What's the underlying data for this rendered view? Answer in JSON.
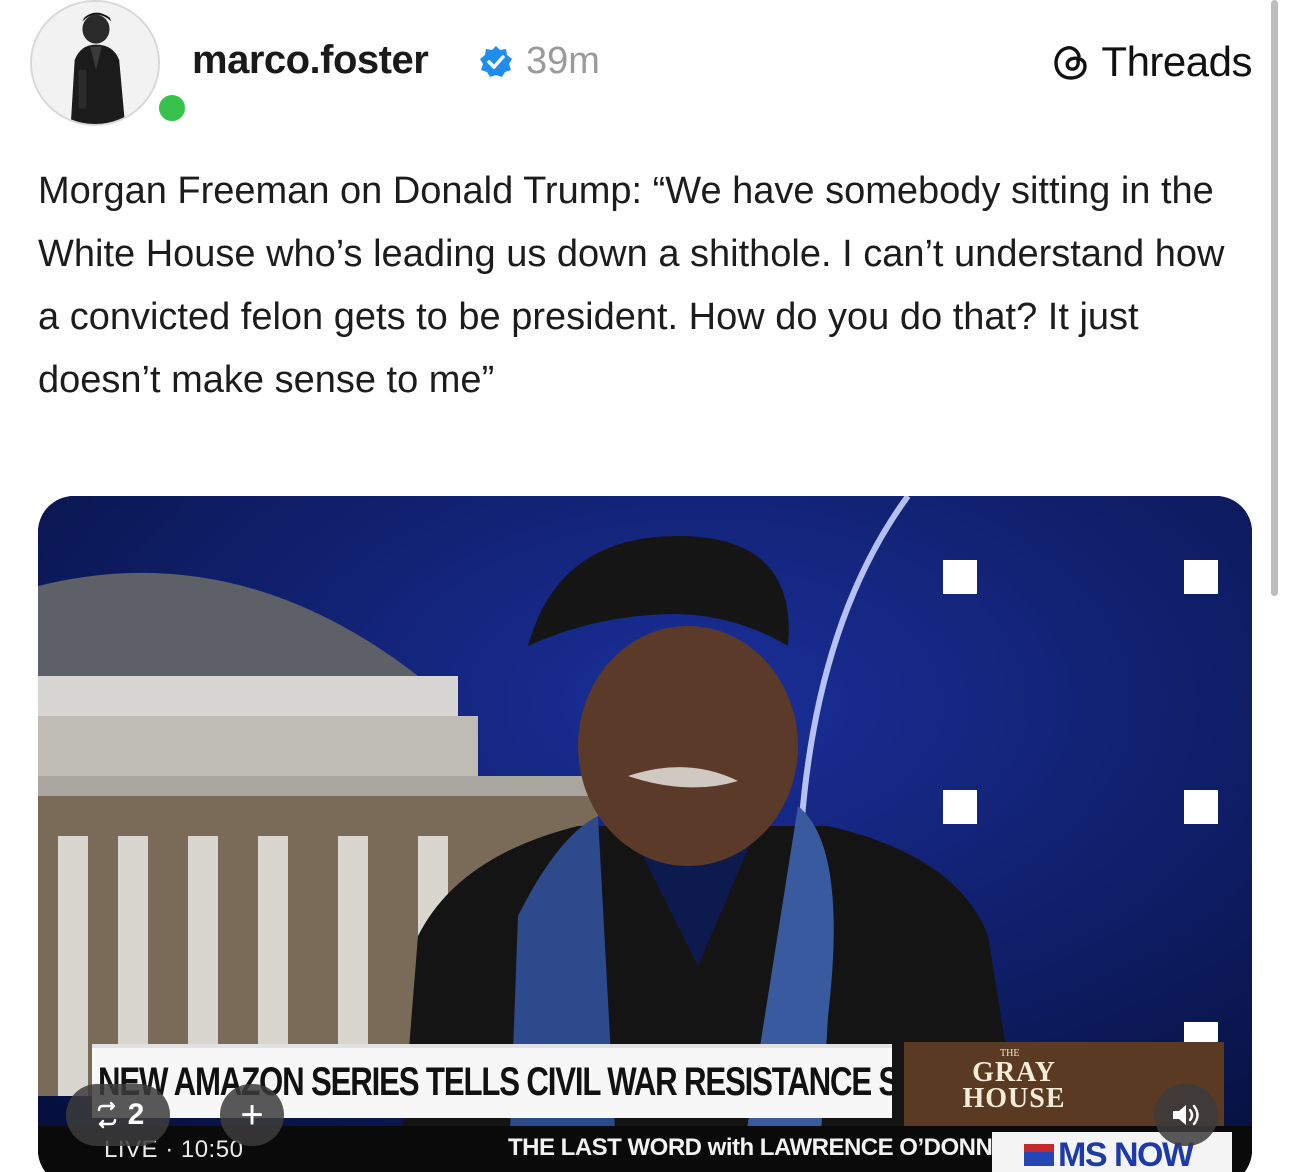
{
  "post": {
    "username": "marco.foster",
    "verified_icon": "verified-badge-icon",
    "timestamp": "39m",
    "platform_label": "Threads",
    "platform_icon": "threads-logo-icon",
    "text": "Morgan Freeman on Donald Trump: “We have somebody sitting in the White House who’s leading us down a shithole. I can’t understand how a convicted felon gets to be president. How do you do that? It just doesn’t make sense to me”"
  },
  "video": {
    "chyron": "NEW AMAZON SERIES TELLS CIVIL WAR RESISTANCE STORY",
    "promo_small": "THE",
    "promo_title_line1": "GRAY",
    "promo_title_line2": "HOUSE",
    "live_time": "LIVE · 10:50",
    "show_name": "THE LAST WORD with LAWRENCE O’DONNELL",
    "network": "MS NOW",
    "repost_count": "2",
    "add_label": "+",
    "repost_icon": "repost-icon",
    "mute_icon": "speaker-icon"
  },
  "colors": {
    "online": "#36c24b",
    "verified": "#1f8cf0",
    "studio_blue": "#0b1a63"
  }
}
